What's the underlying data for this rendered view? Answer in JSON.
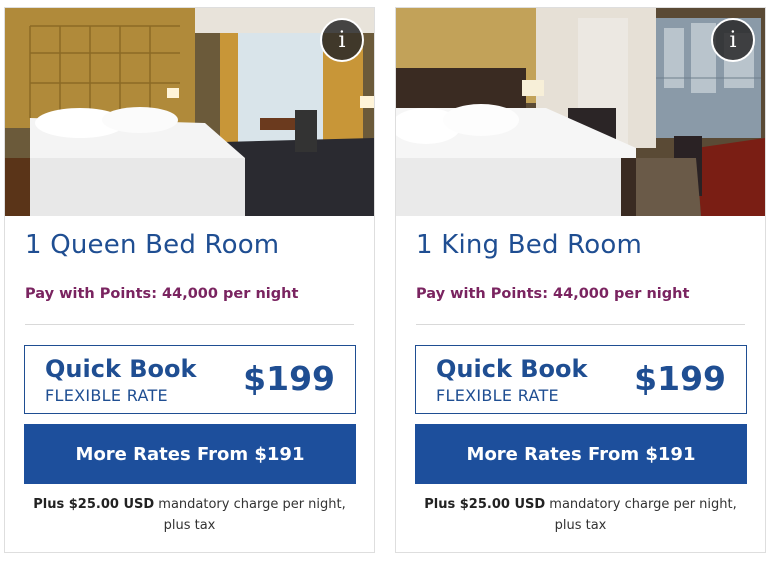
{
  "colors": {
    "brand_blue": "#1f4e92",
    "button_blue": "#1d4f9c",
    "points_purple": "#7a2460"
  },
  "rooms": [
    {
      "title": "1 Queen Bed Room",
      "info_icon": "info-icon",
      "info_label": "i",
      "points_text": "Pay with Points: 44,000 per night",
      "quick_book_title": "Quick Book",
      "quick_book_subtitle": "FLEXIBLE RATE",
      "quick_book_price": "$199",
      "more_rates_label": "More Rates From $191",
      "charge_bold": "Plus $25.00 USD",
      "charge_rest": " mandatory charge per night, plus tax"
    },
    {
      "title": "1 King Bed Room",
      "info_icon": "info-icon",
      "info_label": "i",
      "points_text": "Pay with Points: 44,000 per night",
      "quick_book_title": "Quick Book",
      "quick_book_subtitle": "FLEXIBLE RATE",
      "quick_book_price": "$199",
      "more_rates_label": "More Rates From $191",
      "charge_bold": "Plus $25.00 USD",
      "charge_rest": " mandatory charge per night, plus tax"
    }
  ]
}
